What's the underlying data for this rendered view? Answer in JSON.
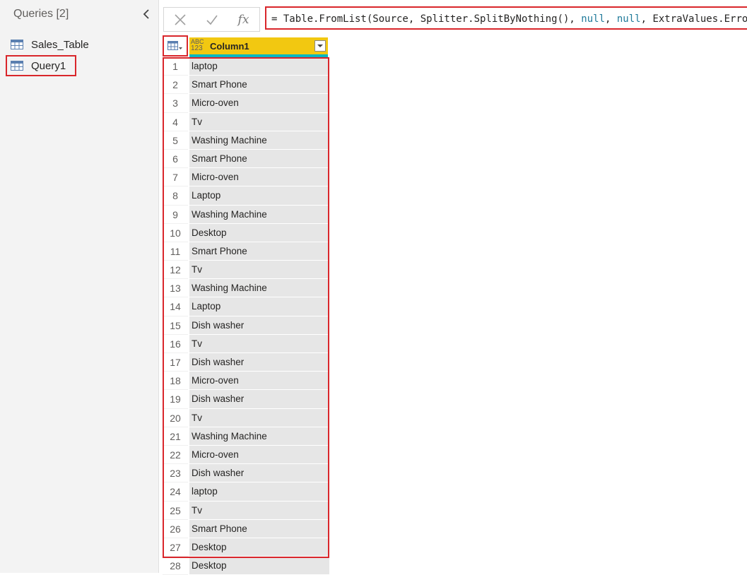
{
  "queries_pane": {
    "title": "Queries [2]",
    "items": [
      {
        "label": "Sales_Table",
        "icon": "table-icon"
      },
      {
        "label": "Query1",
        "icon": "table-icon",
        "selected": true
      }
    ]
  },
  "formula_bar": {
    "cancel_icon": "close-icon",
    "commit_icon": "checkmark-icon",
    "fx_label": "fx",
    "formula_prefix": "= Table.FromList(Source, Splitter.SplitByNothing(), ",
    "null1": "null",
    "sep": ", ",
    "null2": "null",
    "formula_suffix": ", ExtraValues.Error)"
  },
  "grid": {
    "type_label_top": "ABC",
    "type_label_bottom": "123",
    "column_name": "Column1",
    "rows": [
      {
        "n": "1",
        "v": "laptop"
      },
      {
        "n": "2",
        "v": "Smart Phone"
      },
      {
        "n": "3",
        "v": "Micro-oven"
      },
      {
        "n": "4",
        "v": "Tv"
      },
      {
        "n": "5",
        "v": "Washing Machine"
      },
      {
        "n": "6",
        "v": "Smart Phone"
      },
      {
        "n": "7",
        "v": "Micro-oven"
      },
      {
        "n": "8",
        "v": "Laptop"
      },
      {
        "n": "9",
        "v": "Washing Machine"
      },
      {
        "n": "10",
        "v": "Desktop"
      },
      {
        "n": "11",
        "v": "Smart Phone"
      },
      {
        "n": "12",
        "v": "Tv"
      },
      {
        "n": "13",
        "v": "Washing Machine"
      },
      {
        "n": "14",
        "v": "Laptop"
      },
      {
        "n": "15",
        "v": "Dish washer"
      },
      {
        "n": "16",
        "v": "Tv"
      },
      {
        "n": "17",
        "v": "Dish washer"
      },
      {
        "n": "18",
        "v": "Micro-oven"
      },
      {
        "n": "19",
        "v": "Dish washer"
      },
      {
        "n": "20",
        "v": "Tv"
      },
      {
        "n": "21",
        "v": "Washing Machine"
      },
      {
        "n": "22",
        "v": "Micro-oven"
      },
      {
        "n": "23",
        "v": "Dish washer"
      },
      {
        "n": "24",
        "v": "laptop"
      },
      {
        "n": "25",
        "v": "Tv"
      },
      {
        "n": "26",
        "v": "Smart Phone"
      },
      {
        "n": "27",
        "v": "Desktop"
      },
      {
        "n": "28",
        "v": "Desktop"
      }
    ]
  },
  "colors": {
    "highlight": "#d9262b",
    "column_header": "#f2c811",
    "quality_bar": "#00b7c3",
    "null_keyword": "#1f7a9a"
  }
}
